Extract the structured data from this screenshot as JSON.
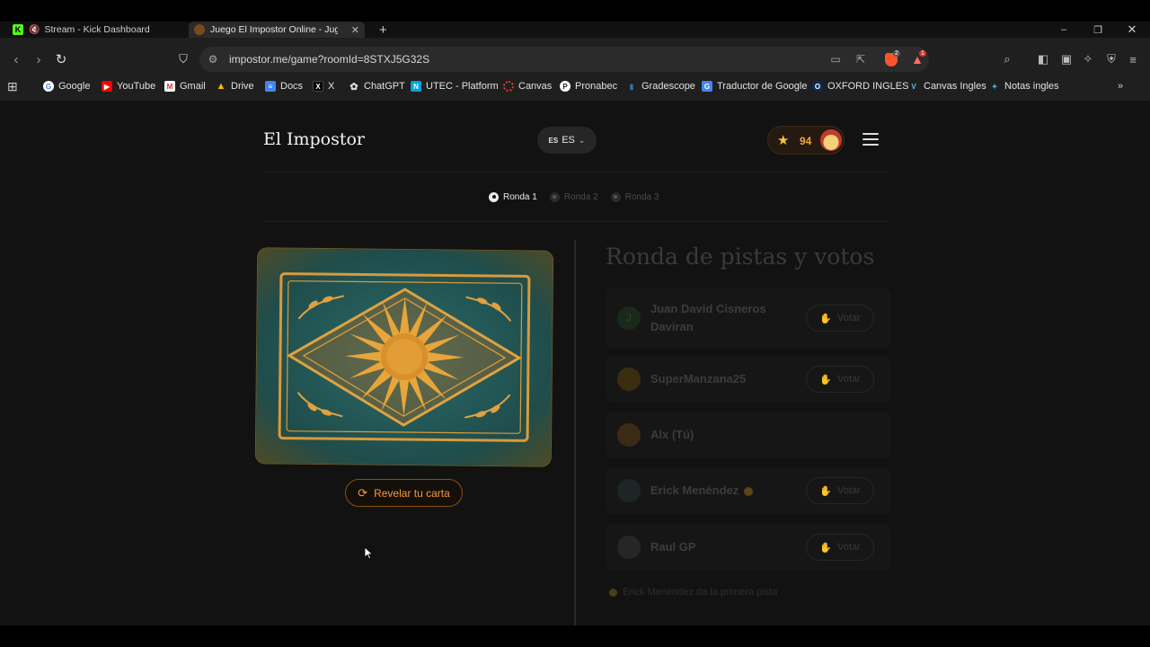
{
  "browser": {
    "tabs": [
      {
        "title": "Stream - Kick Dashboard",
        "active": false
      },
      {
        "title": "Juego El Impostor Online - Jugar",
        "active": true
      }
    ],
    "new_tab": "+",
    "url": "impostor.me/game?roomId=8STXJ5G32S",
    "brave_badge": "2",
    "alert_badge": "1",
    "bookmarks": [
      "Google",
      "YouTube",
      "Gmail",
      "Drive",
      "Docs",
      "X",
      "ChatGPT",
      "UTEC - Platform",
      "Canvas",
      "Pronabec",
      "Gradescope",
      "Traductor de Google",
      "OXFORD INGLES",
      "Canvas Ingles",
      "Notas ingles"
    ],
    "bookmarks_more": "»"
  },
  "header": {
    "brand": "El Impostor",
    "lang_flag": "ES",
    "lang_label": "ES",
    "score": "94"
  },
  "rounds": [
    "Ronda 1",
    "Ronda 2",
    "Ronda 3"
  ],
  "card": {
    "reveal_label": "Revelar tu carta"
  },
  "panel": {
    "title": "Ronda de pistas y votos",
    "vote_label": "Votar",
    "players": [
      {
        "name": "Juan David Cisneros Daviran",
        "initial": "J",
        "votable": true
      },
      {
        "name": "SuperManzana25",
        "votable": true
      },
      {
        "name": "Alx (Tú)",
        "votable": false
      },
      {
        "name": "Erick Menéndez",
        "votable": true
      },
      {
        "name": "Raul GP",
        "votable": true
      }
    ],
    "note": "Erick Menéndez da la primera pista"
  },
  "colors": {
    "accent": "#f39a3c",
    "page_bg": "#121212",
    "chrome_bg": "#1f1f1f"
  }
}
